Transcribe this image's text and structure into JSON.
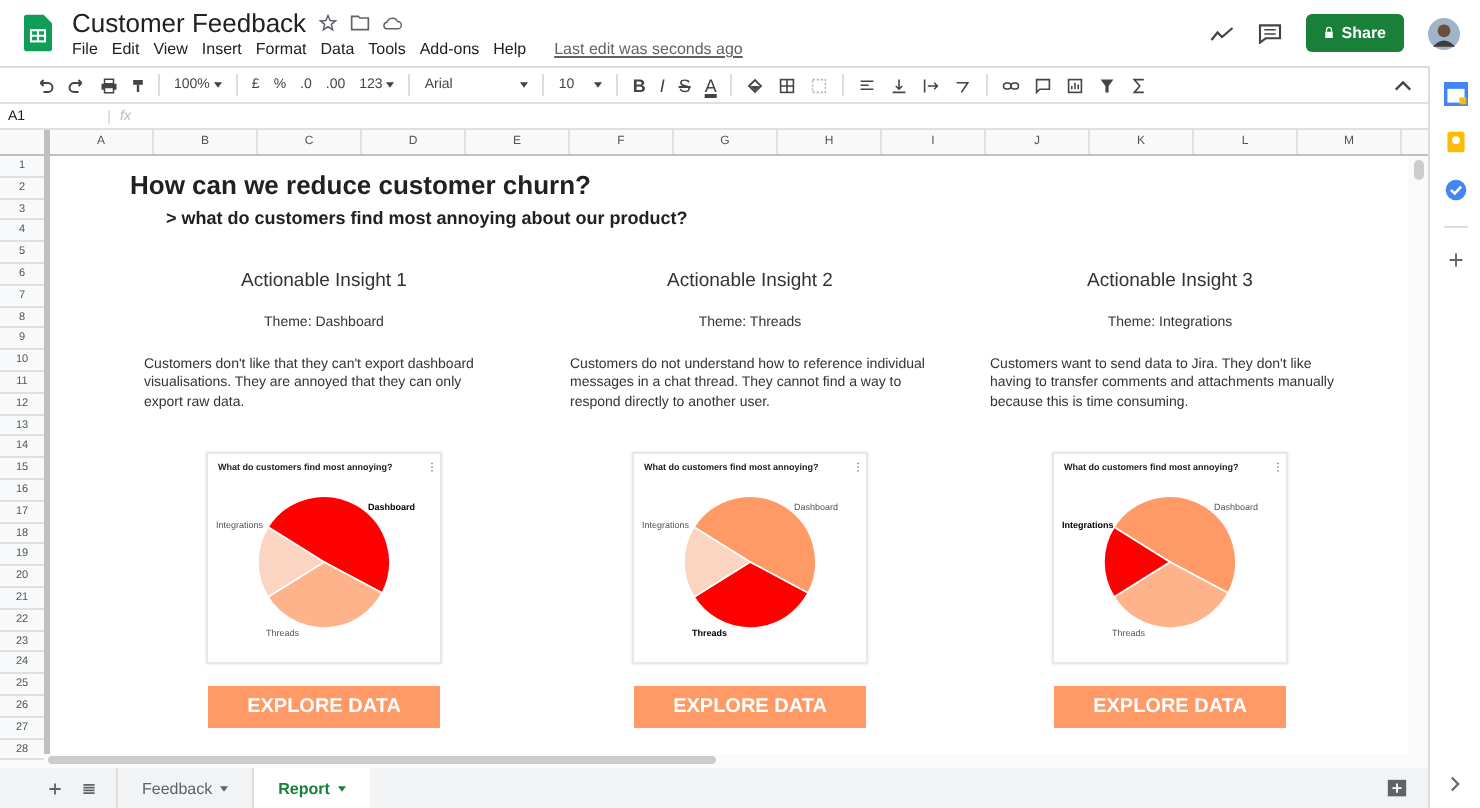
{
  "document": {
    "title": "Customer Feedback",
    "last_edit": "Last edit was seconds ago",
    "share": "Share"
  },
  "menu": [
    "File",
    "Edit",
    "View",
    "Insert",
    "Format",
    "Data",
    "Tools",
    "Add-ons",
    "Help"
  ],
  "toolbar": {
    "zoom": "100%",
    "currency": "£",
    "percent": "%",
    "decrease_decimals": ".0",
    "increase_decimals": ".00",
    "number_format": "123",
    "font": "Arial",
    "font_size": "10",
    "bold": "B",
    "italic": "I",
    "strikethrough": "S",
    "text_color": "A"
  },
  "formula_bar": {
    "cell": "A1",
    "fx": "fx"
  },
  "columns": [
    "A",
    "B",
    "C",
    "D",
    "E",
    "F",
    "G",
    "H",
    "I",
    "J",
    "K",
    "L",
    "M"
  ],
  "rows": [
    "1",
    "2",
    "3",
    "4",
    "5",
    "6",
    "7",
    "8",
    "9",
    "10",
    "11",
    "12",
    "13",
    "14",
    "15",
    "16",
    "17",
    "18",
    "19",
    "20",
    "21",
    "22",
    "23",
    "24",
    "25",
    "26",
    "27",
    "28"
  ],
  "report": {
    "heading": "How can we reduce customer churn?",
    "subheading": "> what do customers find most annoying about our product?",
    "insights": [
      {
        "title": "Actionable Insight 1",
        "theme": "Theme: Dashboard",
        "text": "Customers don't like that they can't export dashboard visualisations. They are annoyed that they can only export raw data.",
        "chart": {
          "title": "What do customers find most annoying?",
          "slices": [
            {
              "label": "Dashboard",
              "highlighted": true
            },
            {
              "label": "Threads",
              "highlighted": false
            },
            {
              "label": "Integrations",
              "highlighted": false
            }
          ]
        },
        "button": "EXPLORE DATA"
      },
      {
        "title": "Actionable Insight 2",
        "theme": "Theme: Threads",
        "text": "Customers do not understand how to reference individual messages in a chat thread. They cannot find a way to respond directly to another user.",
        "chart": {
          "title": "What do customers find most annoying?",
          "slices": [
            {
              "label": "Dashboard",
              "highlighted": false
            },
            {
              "label": "Threads",
              "highlighted": true
            },
            {
              "label": "Integrations",
              "highlighted": false
            }
          ]
        },
        "button": "EXPLORE DATA"
      },
      {
        "title": "Actionable Insight 3",
        "theme": "Theme: Integrations",
        "text": "Customers want to send data to Jira. They don't like having to transfer comments and attachments manually because this is time consuming.",
        "chart": {
          "title": "What do customers find most annoying?",
          "slices": [
            {
              "label": "Dashboard",
              "highlighted": false
            },
            {
              "label": "Threads",
              "highlighted": false
            },
            {
              "label": "Integrations",
              "highlighted": true
            }
          ]
        },
        "button": "EXPLORE DATA"
      }
    ]
  },
  "sheet_tabs": [
    {
      "label": "Feedback",
      "selected": false
    },
    {
      "label": "Report",
      "selected": true
    }
  ]
}
